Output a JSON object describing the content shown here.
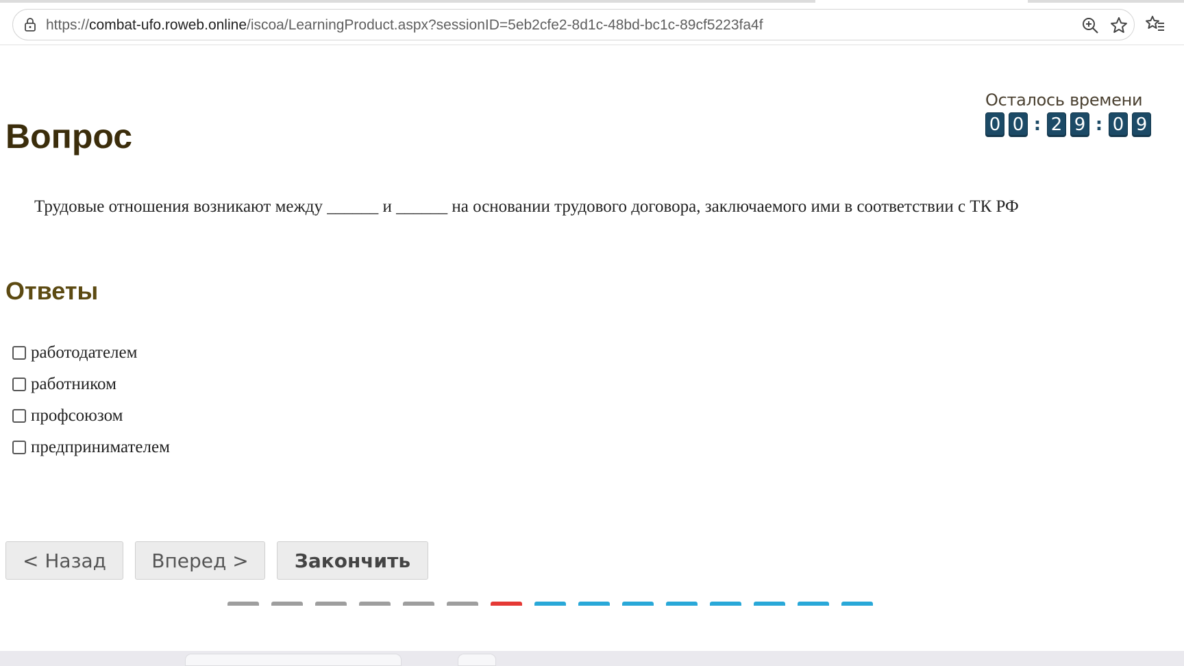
{
  "browser": {
    "url_prefix": "https://",
    "url_host": "combat-ufo.roweb.online",
    "url_path": "/iscoa/LearningProduct.aspx?sessionID=5eb2cfe2-8d1c-48bd-bc1c-89cf5223fa4f",
    "icons": [
      "lock-icon",
      "zoom-icon",
      "star-icon",
      "favorites-icon"
    ]
  },
  "page": {
    "title": "Вопрос",
    "timer": {
      "label": "Осталось времени",
      "digits": [
        "0",
        "0",
        "2",
        "9",
        "0",
        "9"
      ],
      "separator": ":"
    },
    "question": "Трудовые отношения возникают между ______ и ______ на основании трудового договора, заключаемого ими в соответствии с ТК РФ",
    "answers_title": "Ответы",
    "answers": [
      {
        "label": "работодателем",
        "checked": false
      },
      {
        "label": "работником",
        "checked": false
      },
      {
        "label": "профсоюзом",
        "checked": false
      },
      {
        "label": "предпринимателем",
        "checked": false
      }
    ],
    "buttons": {
      "back": "< Назад",
      "forward": "Вперед >",
      "finish": "Закончить"
    },
    "progress_colors": [
      "#9e9e9e",
      "#9e9e9e",
      "#9e9e9e",
      "#9e9e9e",
      "#9e9e9e",
      "#9e9e9e",
      "#e53935",
      "#29a8d8",
      "#29a8d8",
      "#29a8d8",
      "#29a8d8",
      "#29a8d8",
      "#29a8d8",
      "#29a8d8",
      "#29a8d8"
    ]
  }
}
